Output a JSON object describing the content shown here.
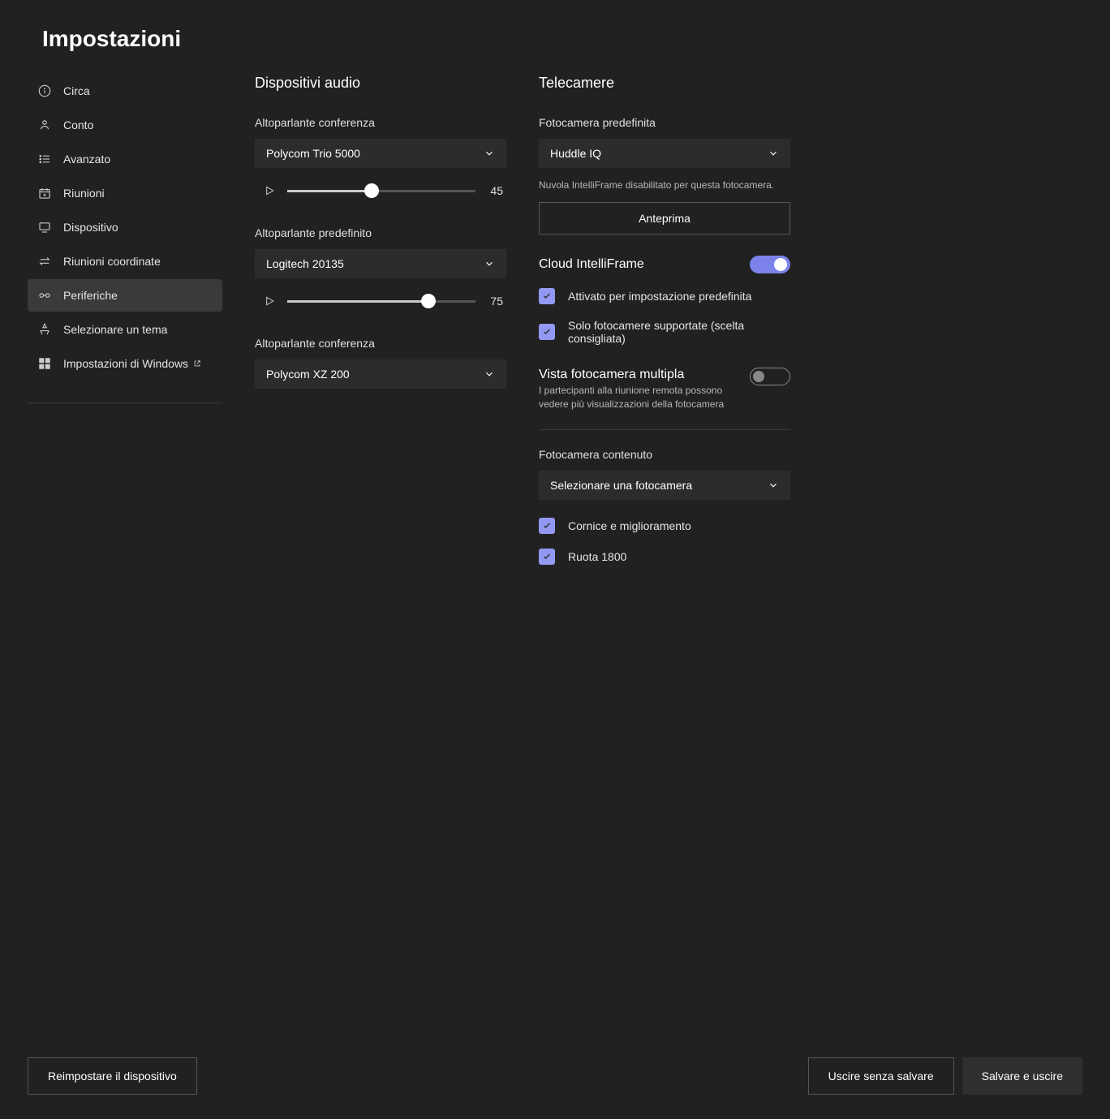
{
  "pageTitle": "Impostazioni",
  "sidebar": {
    "items": [
      {
        "label": "Circa"
      },
      {
        "label": "Conto"
      },
      {
        "label": "Avanzato"
      },
      {
        "label": "Riunioni"
      },
      {
        "label": "Dispositivo"
      },
      {
        "label": "Riunioni coordinate"
      },
      {
        "label": "Periferiche"
      },
      {
        "label": "Selezionare un tema"
      },
      {
        "label": "Impostazioni di Windows"
      }
    ]
  },
  "audio": {
    "title": "Dispositivi audio",
    "confSpeakerLabel": "Altoparlante conferenza",
    "confSpeakerValue": "Polycom Trio 5000",
    "confSpeakerVolume": 45,
    "defaultSpeakerLabel": "Altoparlante predefinito",
    "defaultSpeakerValue": "Logitech 20135",
    "defaultSpeakerVolume": 75,
    "confSpeaker2Label": "Altoparlante conferenza",
    "confSpeaker2Value": "Polycom XZ 200"
  },
  "cameras": {
    "title": "Telecamere",
    "defaultCameraLabel": "Fotocamera predefinita",
    "defaultCameraValue": "Huddle IQ",
    "intelliNote": "Nuvola IntelliFrame disabilitato per questa fotocamera.",
    "previewLabel": "Anteprima",
    "cloudIntelliTitle": "Cloud IntelliFrame",
    "cloudIntelliOn": true,
    "checkbox1": "Attivato per impostazione predefinita",
    "checkbox2": "Solo fotocamere supportate (scelta consigliata)",
    "multiViewTitle": "Vista fotocamera multipla",
    "multiViewDesc": "I partecipanti alla riunione remota possono vedere più visualizzazioni della fotocamera",
    "multiViewOn": false,
    "contentCameraLabel": "Fotocamera contenuto",
    "contentCameraValue": "Selezionare una fotocamera",
    "checkbox3": "Cornice e miglioramento",
    "checkbox4": "Ruota 1800"
  },
  "footer": {
    "reset": "Reimpostare il dispositivo",
    "exitNoSave": "Uscire senza salvare",
    "saveExit": "Salvare e uscire"
  }
}
